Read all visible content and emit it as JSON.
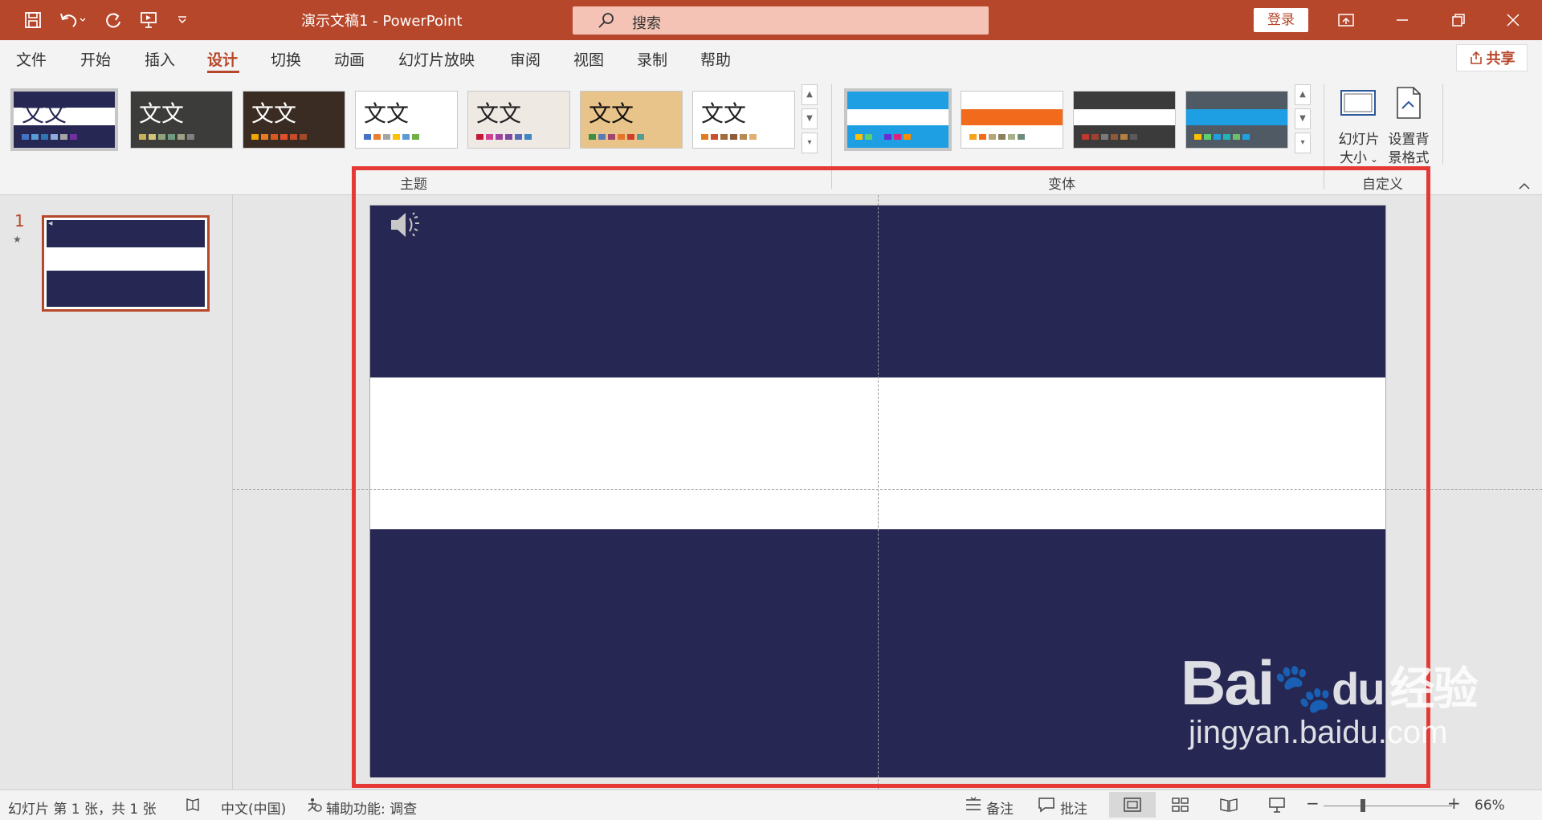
{
  "titlebar": {
    "doc_title": "演示文稿1  -  PowerPoint",
    "search_placeholder": "搜索",
    "login_label": "登录"
  },
  "menu": {
    "tabs": [
      "文件",
      "开始",
      "插入",
      "设计",
      "切换",
      "动画",
      "幻灯片放映",
      "审阅",
      "视图",
      "录制",
      "帮助"
    ],
    "active_tab": "设计",
    "share_label": "共享"
  },
  "ribbon": {
    "themes": [
      {
        "text": "文文",
        "bg": "#ffffff",
        "accent": "#262752",
        "fg": "#ffffff",
        "swatches": [
          "#4472c4",
          "#5b9bd5",
          "#2e75b6",
          "#8faadc",
          "#a5a5a5",
          "#7030a0"
        ]
      },
      {
        "text": "文文",
        "bg": "#3c3d3a",
        "accent": "#3c3d3a",
        "fg": "#ffffff",
        "swatches": [
          "#c9b15b",
          "#d7c27a",
          "#8fa47c",
          "#6f9b7f",
          "#a0a084",
          "#808080"
        ]
      },
      {
        "text": "文文",
        "bg": "#3a2c22",
        "accent": "#3a2c22",
        "fg": "#ffffff",
        "swatches": [
          "#f3a500",
          "#e97b21",
          "#d75a21",
          "#e24f2a",
          "#c84c2a",
          "#a34a2b"
        ]
      },
      {
        "text": "文文",
        "bg": "#ffffff",
        "accent": "#ffffff",
        "fg": "#222222",
        "swatches": [
          "#4472c4",
          "#ed7d31",
          "#a5a5a5",
          "#ffc000",
          "#5b9bd5",
          "#70ad47"
        ]
      },
      {
        "text": "文文",
        "bg": "#efe9e4",
        "accent": "#efe9e4",
        "fg": "#222222",
        "swatches": [
          "#c3183a",
          "#d1408f",
          "#9e3fa1",
          "#7c4aa1",
          "#596ab6",
          "#3e86c3"
        ]
      },
      {
        "text": "文文",
        "bg": "#e9c48a",
        "accent": "#e9c48a",
        "fg": "#111111",
        "swatches": [
          "#3e8e41",
          "#5a7ab5",
          "#a0446b",
          "#e5752a",
          "#cf3d2b",
          "#4d9c95"
        ]
      },
      {
        "text": "文文",
        "bg": "#ffffff",
        "accent": "#ffffff",
        "fg": "#222222",
        "swatches": [
          "#e07b20",
          "#c9502a",
          "#a36a3a",
          "#8c5b3a",
          "#b58a55",
          "#e0b070"
        ]
      }
    ],
    "variants": [
      {
        "top": "#1e9fe3",
        "mid": "#ffffff",
        "bot": "#1e9fe3",
        "swatches": [
          "#ffc000",
          "#5bd06c",
          "#1e9fe3",
          "#6b2bd0",
          "#e2207c",
          "#ff8c00"
        ]
      },
      {
        "top": "#ffffff",
        "mid": "#f26a1b",
        "bot": "#ffffff",
        "swatches": [
          "#f7a21b",
          "#f26a1b",
          "#b5a57a",
          "#8b7f5a",
          "#a8b18a",
          "#6e8b7a"
        ]
      },
      {
        "top": "#3b3b3b",
        "mid": "#ffffff",
        "bot": "#3b3b3b",
        "swatches": [
          "#c0392b",
          "#a04030",
          "#7a7a7a",
          "#8e5a3a",
          "#b38040",
          "#5a5a5a"
        ]
      },
      {
        "top": "#505a65",
        "mid": "#1e9fe3",
        "bot": "#505a65",
        "swatches": [
          "#ffc000",
          "#5bd06c",
          "#1e9fe3",
          "#23b5b5",
          "#6cc06c",
          "#1fa2e3"
        ]
      }
    ],
    "group_labels": {
      "themes": "主题",
      "variants": "变体",
      "customize": "自定义"
    },
    "slide_size_label_1": "幻灯片",
    "slide_size_label_2": "大小",
    "format_bg_label_1": "设置背",
    "format_bg_label_2": "景格式"
  },
  "slides_panel": {
    "slide_number": "1"
  },
  "watermark": {
    "main": "Bai",
    "paw": "du",
    "tail": "经验",
    "sub": "jingyan.baidu.com"
  },
  "statusbar": {
    "slide_info": "幻灯片 第 1 张，共 1 张",
    "language": "中文(中国)",
    "accessibility": "辅助功能: 调查",
    "notes_label": "备注",
    "comments_label": "批注",
    "zoom_minus": "−",
    "zoom_plus": "+",
    "zoom_level": "66%"
  },
  "colors": {
    "brand": "#b7472a",
    "slide_band": "#262752",
    "highlight": "#e53935"
  }
}
